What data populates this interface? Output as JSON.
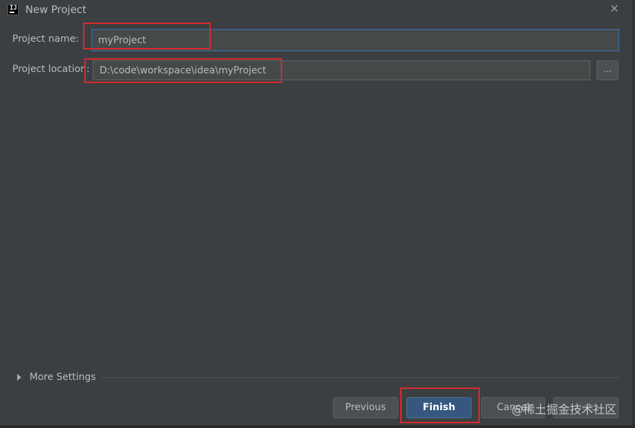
{
  "window": {
    "title": "New Project",
    "app_icon_text": "IJ",
    "close_glyph": "✕"
  },
  "form": {
    "project_name": {
      "label": "Project name:",
      "value": "myProject"
    },
    "project_location": {
      "label": "Project location:",
      "value": "D:\\code\\workspace\\idea\\myProject",
      "browse_label": "..."
    }
  },
  "more_settings": {
    "label": "More Settings",
    "expanded": false
  },
  "buttons": {
    "previous": "Previous",
    "finish": "Finish",
    "cancel": "Cancel",
    "help": "Help"
  },
  "watermark": "@稀土掘金技术社区",
  "colors": {
    "background": "#3c3f41",
    "primary_button": "#365880",
    "highlight_box": "#e0282c",
    "focus_border": "#3d6185"
  }
}
